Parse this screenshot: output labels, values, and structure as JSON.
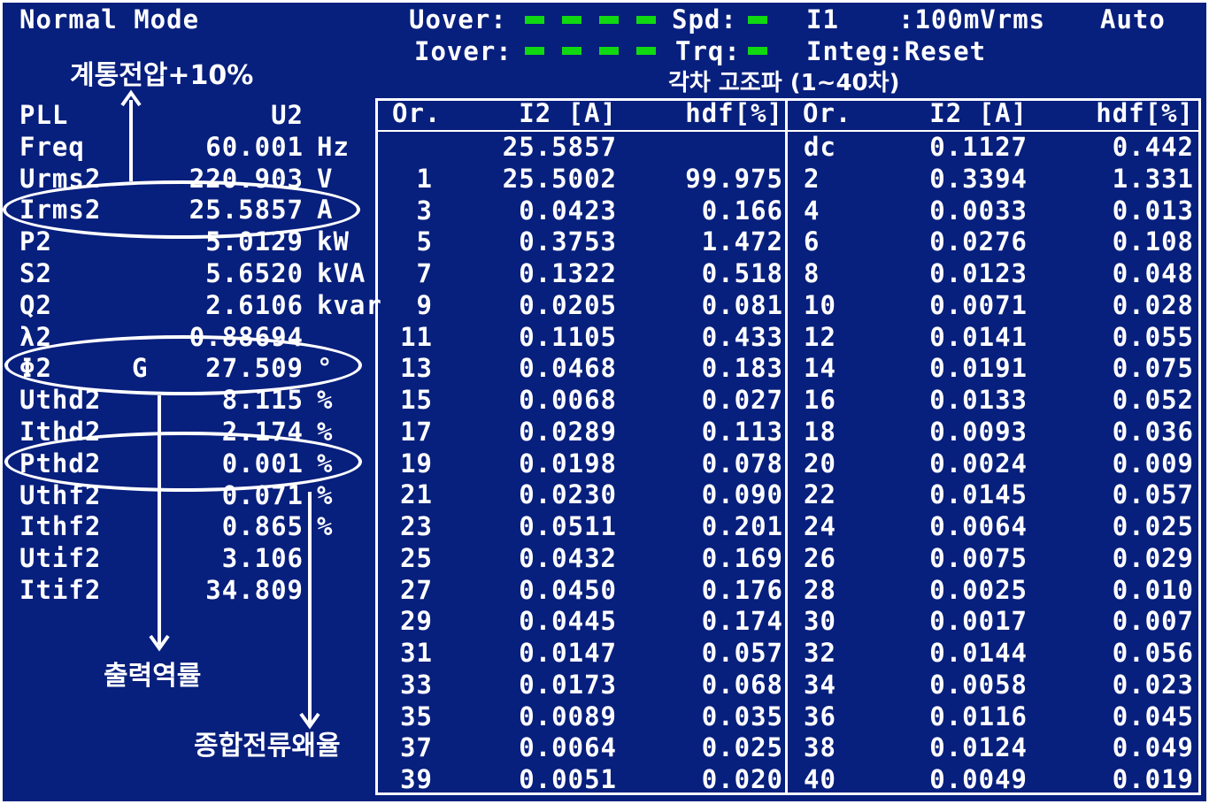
{
  "header": {
    "mode": "Normal Mode",
    "uover_label": "Uover:",
    "iover_label": "Iover:",
    "spd_label": "Spd:",
    "trq_label": "Trq:",
    "i1_label": "I1",
    "range_value": ":100mVrms",
    "range_mode": "Auto",
    "integ": "Integ:Reset",
    "led_color": "#11d911"
  },
  "left_panel": {
    "rows": [
      {
        "label": "PLL",
        "value": "U2",
        "unit": ""
      },
      {
        "label": "Freq",
        "value": "60.001",
        "unit": "Hz"
      },
      {
        "label": "Urms2",
        "value": "220.903",
        "unit": "V"
      },
      {
        "label": "Irms2",
        "value": "25.5857",
        "unit": "A"
      },
      {
        "label": "P2",
        "value": "5.0129",
        "unit": "kW"
      },
      {
        "label": "S2",
        "value": "5.6520",
        "unit": "kVA"
      },
      {
        "label": "Q2",
        "value": "2.6106",
        "unit": "kvar"
      },
      {
        "label": "λ2",
        "value": "0.88694",
        "unit": ""
      },
      {
        "label": "Φ2",
        "value": "27.509",
        "unit": "°",
        "flag": "G"
      },
      {
        "label": "Uthd2",
        "value": "8.115",
        "unit": "%"
      },
      {
        "label": "Ithd2",
        "value": "2.174",
        "unit": "%"
      },
      {
        "label": "Pthd2",
        "value": "0.001",
        "unit": "%"
      },
      {
        "label": "Uthf2",
        "value": "0.071",
        "unit": "%"
      },
      {
        "label": "Ithf2",
        "value": "0.865",
        "unit": "%"
      },
      {
        "label": "Utif2",
        "value": "3.106",
        "unit": ""
      },
      {
        "label": "Itif2",
        "value": "34.809",
        "unit": ""
      }
    ]
  },
  "harmonics": {
    "headers": {
      "order": "Or.",
      "current": "I2 [A]",
      "hdf": "hdf[%]"
    },
    "left": [
      {
        "or": "",
        "i": "25.5857",
        "hdf": ""
      },
      {
        "or": "1",
        "i": "25.5002",
        "hdf": "99.975"
      },
      {
        "or": "3",
        "i": "0.0423",
        "hdf": "0.166"
      },
      {
        "or": "5",
        "i": "0.3753",
        "hdf": "1.472"
      },
      {
        "or": "7",
        "i": "0.1322",
        "hdf": "0.518"
      },
      {
        "or": "9",
        "i": "0.0205",
        "hdf": "0.081"
      },
      {
        "or": "11",
        "i": "0.1105",
        "hdf": "0.433"
      },
      {
        "or": "13",
        "i": "0.0468",
        "hdf": "0.183"
      },
      {
        "or": "15",
        "i": "0.0068",
        "hdf": "0.027"
      },
      {
        "or": "17",
        "i": "0.0289",
        "hdf": "0.113"
      },
      {
        "or": "19",
        "i": "0.0198",
        "hdf": "0.078"
      },
      {
        "or": "21",
        "i": "0.0230",
        "hdf": "0.090"
      },
      {
        "or": "23",
        "i": "0.0511",
        "hdf": "0.201"
      },
      {
        "or": "25",
        "i": "0.0432",
        "hdf": "0.169"
      },
      {
        "or": "27",
        "i": "0.0450",
        "hdf": "0.176"
      },
      {
        "or": "29",
        "i": "0.0445",
        "hdf": "0.174"
      },
      {
        "or": "31",
        "i": "0.0147",
        "hdf": "0.057"
      },
      {
        "or": "33",
        "i": "0.0173",
        "hdf": "0.068"
      },
      {
        "or": "35",
        "i": "0.0089",
        "hdf": "0.035"
      },
      {
        "or": "37",
        "i": "0.0064",
        "hdf": "0.025"
      },
      {
        "or": "39",
        "i": "0.0051",
        "hdf": "0.020"
      }
    ],
    "right": [
      {
        "or": "dc",
        "i": "0.1127",
        "hdf": "0.442"
      },
      {
        "or": "2",
        "i": "0.3394",
        "hdf": "1.331"
      },
      {
        "or": "4",
        "i": "0.0033",
        "hdf": "0.013"
      },
      {
        "or": "6",
        "i": "0.0276",
        "hdf": "0.108"
      },
      {
        "or": "8",
        "i": "0.0123",
        "hdf": "0.048"
      },
      {
        "or": "10",
        "i": "0.0071",
        "hdf": "0.028"
      },
      {
        "or": "12",
        "i": "0.0141",
        "hdf": "0.055"
      },
      {
        "or": "14",
        "i": "0.0191",
        "hdf": "0.075"
      },
      {
        "or": "16",
        "i": "0.0133",
        "hdf": "0.052"
      },
      {
        "or": "18",
        "i": "0.0093",
        "hdf": "0.036"
      },
      {
        "or": "20",
        "i": "0.0024",
        "hdf": "0.009"
      },
      {
        "or": "22",
        "i": "0.0145",
        "hdf": "0.057"
      },
      {
        "or": "24",
        "i": "0.0064",
        "hdf": "0.025"
      },
      {
        "or": "26",
        "i": "0.0075",
        "hdf": "0.029"
      },
      {
        "or": "28",
        "i": "0.0025",
        "hdf": "0.010"
      },
      {
        "or": "30",
        "i": "0.0017",
        "hdf": "0.007"
      },
      {
        "or": "32",
        "i": "0.0144",
        "hdf": "0.056"
      },
      {
        "or": "34",
        "i": "0.0058",
        "hdf": "0.023"
      },
      {
        "or": "36",
        "i": "0.0116",
        "hdf": "0.045"
      },
      {
        "or": "38",
        "i": "0.0124",
        "hdf": "0.049"
      },
      {
        "or": "40",
        "i": "0.0049",
        "hdf": "0.019"
      }
    ]
  },
  "annotations": {
    "voltage": "계통전압+10%",
    "harmonics_title": "각차 고조파 (1~40차)",
    "power_factor": "출력역률",
    "current_thd": "종합전류왜율"
  }
}
